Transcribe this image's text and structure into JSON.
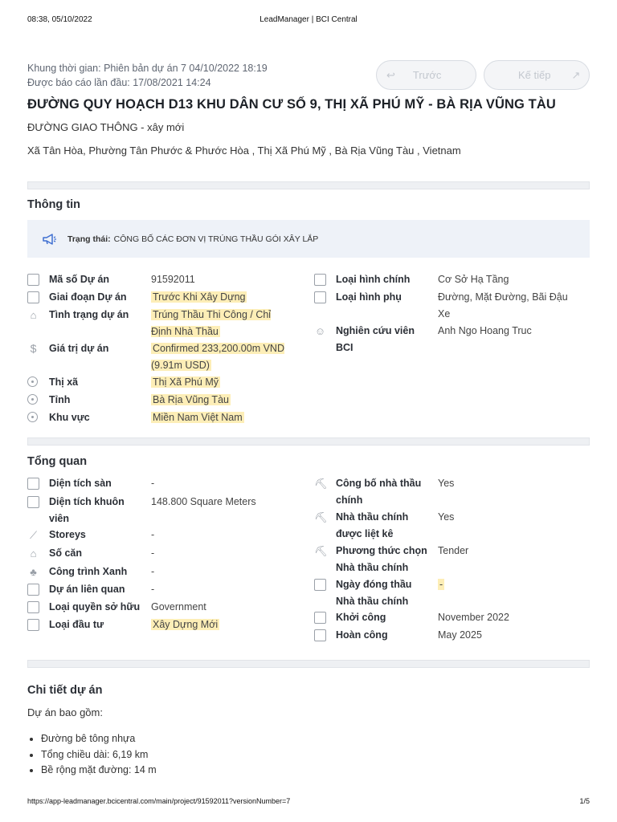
{
  "print": {
    "datetime": "08:38, 05/10/2022",
    "doc_title": "LeadManager | BCI Central",
    "url": "https://app-leadmanager.bcicentral.com/main/project/91592011?versionNumber=7",
    "page": "1/5"
  },
  "meta": {
    "timeframe": "Khung thời gian: Phiên bản dự án 7 04/10/2022 18:19",
    "first_reported": "Được báo cáo lần đầu: 17/08/2021 14:24"
  },
  "nav": {
    "prev_label": "Trước",
    "next_label": "Kế tiếp",
    "prev_icon": "↩",
    "next_icon": "↗"
  },
  "project": {
    "title": "ĐƯỜNG QUY HOẠCH D13 KHU DÂN CƯ SỐ 9, THỊ XÃ PHÚ MỸ - BÀ RỊA VŨNG TÀU",
    "category": "ĐƯỜNG GIAO THÔNG - xây mới",
    "address": "Xã Tân Hòa, Phường Tân Phước & Phước Hòa , Thị Xã Phú Mỹ , Bà Rịa Vũng Tàu , Vietnam"
  },
  "info": {
    "section_title": "Thông tin",
    "status_label": "Trạng thái:",
    "status_value": "CÔNG BỐ CÁC ĐƠN VỊ TRÚNG THẦU GÓI XÂY LẮP",
    "left": [
      {
        "label": "Mã số Dự án",
        "value": "91592011",
        "icon": "id-card-icon"
      },
      {
        "label": "Giai đoạn Dự án",
        "value": "Trước Khi Xây Dựng",
        "icon": "stage-icon"
      },
      {
        "label": "Tình trạng dự án",
        "value": "Trúng Thầu Thi Công / Chỉ Định Nhà Thầu",
        "icon": "status-icon"
      },
      {
        "label": "Giá trị dự án",
        "value": "Confirmed 233,200.00m VND (9.91m USD)",
        "icon": "dollar-icon"
      },
      {
        "label": "Thị xã",
        "value": "Thị Xã Phú Mỹ",
        "icon": "location-pin-icon"
      },
      {
        "label": "Tỉnh",
        "value": "Bà Rịa Vũng Tàu",
        "icon": "location-pin-icon"
      },
      {
        "label": "Khu vực",
        "value": "Miền Nam Việt Nam",
        "icon": "location-pin-icon"
      }
    ],
    "right": [
      {
        "label": "Loại hình chính",
        "value": "Cơ Sở Hạ Tầng",
        "icon": "building-type-icon"
      },
      {
        "label": "Loại hình phụ",
        "value": "Đường, Mặt Đường, Bãi Đậu Xe",
        "icon": "building-subtype-icon"
      },
      {
        "label": "Nghiên cứu viên BCI",
        "value": "Anh Ngo Hoang Truc",
        "icon": "researcher-icon"
      }
    ]
  },
  "overview": {
    "section_title": "Tổng quan",
    "left": [
      {
        "label": "Diện tích sàn",
        "value": "-"
      },
      {
        "label": "Diện tích khuôn viên",
        "value": "148.800 Square Meters"
      },
      {
        "label": "Storeys",
        "value": "-"
      },
      {
        "label": "Số căn",
        "value": "-"
      },
      {
        "label": "Công trình Xanh",
        "value": "-"
      },
      {
        "label": "Dự án liên quan",
        "value": "-"
      },
      {
        "label": "Loại quyền sở hữu",
        "value": "Government"
      },
      {
        "label": "Loại đầu tư",
        "value": "Xây Dựng Mới"
      }
    ],
    "right": [
      {
        "label": "Công bố nhà thầu chính",
        "value": "Yes"
      },
      {
        "label": "Nhà thầu chính được liệt kê",
        "value": "Yes"
      },
      {
        "label": "Phương thức chọn Nhà thầu chính",
        "value": "Tender"
      },
      {
        "label": "Ngày đóng thầu Nhà thầu chính",
        "value": "-"
      },
      {
        "label": "Khởi công",
        "value": "November 2022"
      },
      {
        "label": "Hoàn công",
        "value": "May 2025"
      }
    ]
  },
  "details": {
    "section_title": "Chi tiết dự án",
    "intro": "Dự án bao gồm:",
    "items": [
      "Đường bê tông nhựa",
      "Tổng chiều dài: 6,19 km",
      "Bề rộng mặt đường: 14 m"
    ]
  },
  "colors": {
    "highlight": "#fdeeb7",
    "status_bg": "#eef2f8",
    "accent": "#3f6fd1"
  }
}
